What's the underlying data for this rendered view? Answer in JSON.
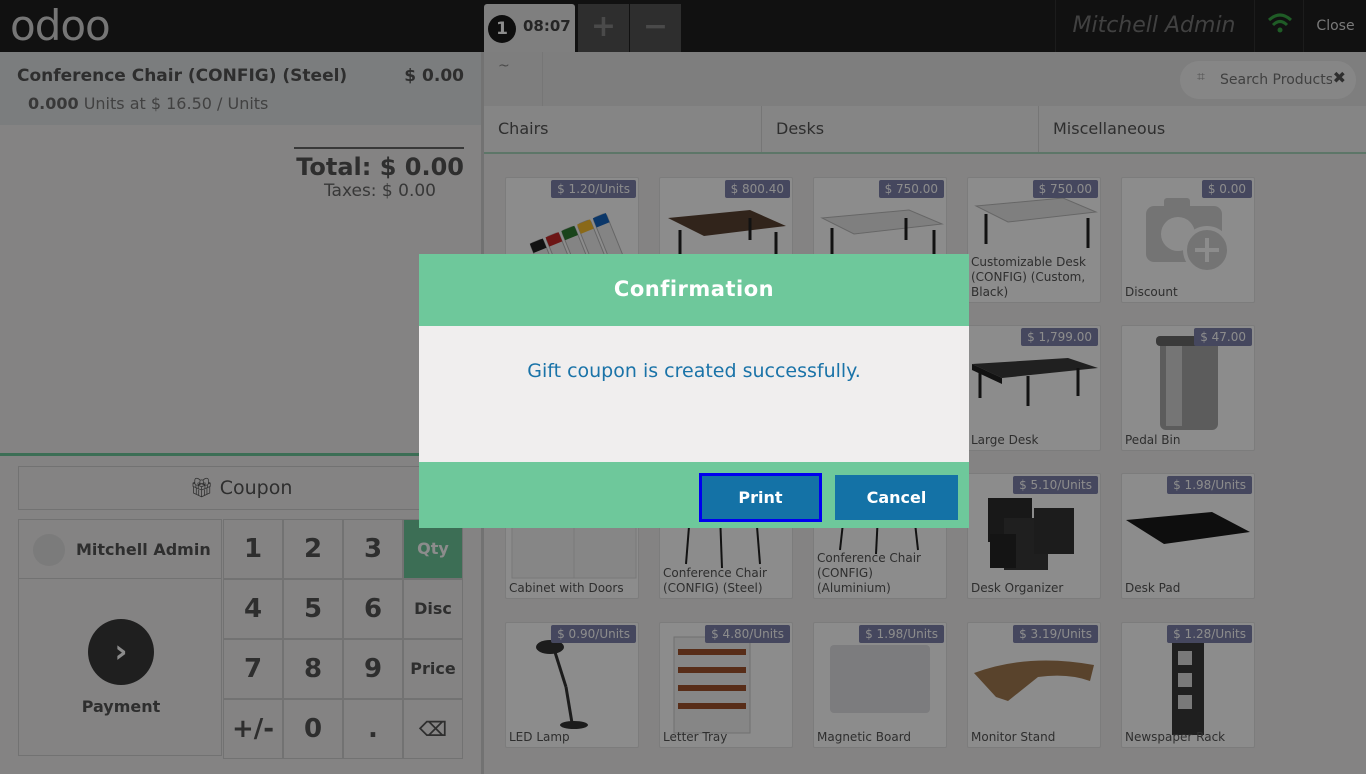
{
  "header": {
    "logo": "odoo",
    "order_number": "1",
    "order_time": "08:07",
    "add_order": "+",
    "remove_order": "−",
    "user": "Mitchell Admin",
    "close": "Close"
  },
  "orderline": {
    "name": "Conference Chair (CONFIG) (Steel)",
    "price": "$ 0.00",
    "qty": "0.000",
    "detail": " Units at $ 16.50 / Units"
  },
  "summary": {
    "total": "Total: $ 0.00",
    "taxes": "Taxes: $ 0.00"
  },
  "actions": {
    "coupon": "Coupon",
    "customer": "Mitchell Admin",
    "payment": "Payment"
  },
  "numpad": {
    "keys": [
      "1",
      "2",
      "3",
      "Qty",
      "4",
      "5",
      "6",
      "Disc",
      "7",
      "8",
      "9",
      "Price",
      "+/-",
      "0",
      ".",
      "⌫"
    ]
  },
  "search": {
    "placeholder": "Search Products"
  },
  "breadcrumb": "~",
  "categories": [
    "Chairs",
    "Desks",
    "Miscellaneous"
  ],
  "products": [
    {
      "name": "",
      "price": "$ 1.20/Units"
    },
    {
      "name": "",
      "price": "$ 800.40"
    },
    {
      "name": "",
      "price": "$ 750.00"
    },
    {
      "name": "Customizable Desk (CONFIG) (Custom, Black)",
      "price": "$ 750.00"
    },
    {
      "name": "Discount",
      "price": "$ 0.00"
    },
    {
      "name": "Large Desk",
      "price": "$ 1,799.00"
    },
    {
      "name": "Pedal Bin",
      "price": "$ 47.00"
    },
    {
      "name": "Cabinet with Doors",
      "price": ""
    },
    {
      "name": "Conference Chair (CONFIG) (Steel)",
      "price": ""
    },
    {
      "name": "Conference Chair (CONFIG) (Aluminium)",
      "price": ""
    },
    {
      "name": "Desk Organizer",
      "price": "$ 5.10/Units"
    },
    {
      "name": "Desk Pad",
      "price": "$ 1.98/Units"
    },
    {
      "name": "LED Lamp",
      "price": "$ 0.90/Units"
    },
    {
      "name": "Letter Tray",
      "price": "$ 4.80/Units"
    },
    {
      "name": "Magnetic Board",
      "price": "$ 1.98/Units"
    },
    {
      "name": "Monitor Stand",
      "price": "$ 3.19/Units"
    },
    {
      "name": "Newspaper Rack",
      "price": "$ 1.28/Units"
    }
  ],
  "dialog": {
    "title": "Confirmation",
    "message": "Gift coupon is created successfully.",
    "print": "Print",
    "cancel": "Cancel"
  },
  "colors": {
    "accent": "#6ec89b",
    "button": "#1472a6",
    "price_tag": "#7f82ac",
    "topbar": "#1f1f1f"
  }
}
